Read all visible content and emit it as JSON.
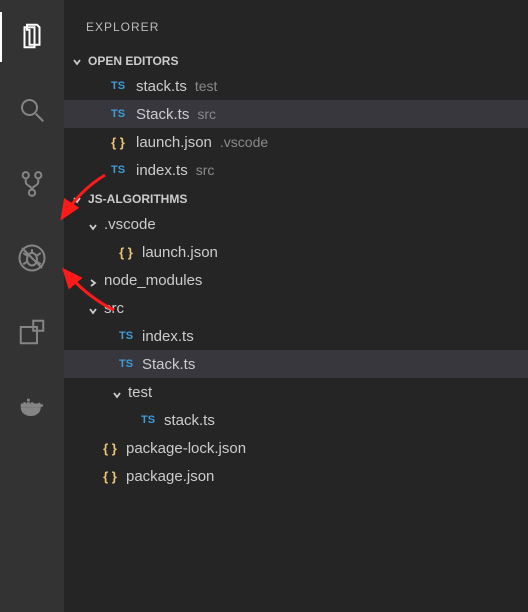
{
  "panelTitle": "EXPLORER",
  "sections": {
    "openEditors": {
      "label": "OPEN EDITORS",
      "items": [
        {
          "icon": "ts",
          "name": "stack.ts",
          "desc": "test"
        },
        {
          "icon": "ts",
          "name": "Stack.ts",
          "desc": "src"
        },
        {
          "icon": "json",
          "name": "launch.json",
          "desc": ".vscode"
        },
        {
          "icon": "ts",
          "name": "index.ts",
          "desc": "src"
        }
      ]
    },
    "workspace": {
      "label": "JS-ALGORITHMS",
      "tree": {
        "vscode": {
          "label": ".vscode",
          "launch": "launch.json"
        },
        "node_modules": "node_modules",
        "src": {
          "label": "src",
          "index": "index.ts",
          "stack": "Stack.ts",
          "test": {
            "label": "test",
            "stack": "stack.ts"
          }
        },
        "pkgLock": "package-lock.json",
        "pkg": "package.json"
      }
    }
  },
  "icons": {
    "ts": "TS",
    "json": "{ }"
  }
}
